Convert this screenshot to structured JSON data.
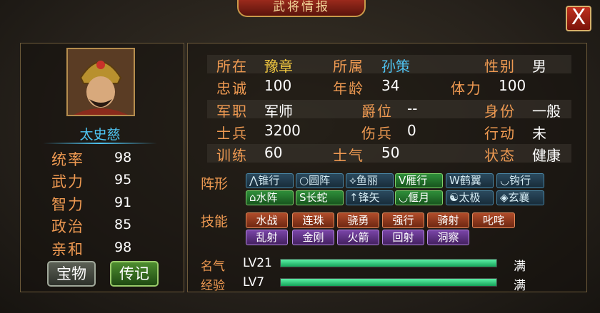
{
  "window": {
    "title": "武将情报",
    "close_label": "X"
  },
  "general": {
    "name": "太史慈",
    "attributes": [
      {
        "label": "统率",
        "value": "98"
      },
      {
        "label": "武力",
        "value": "95"
      },
      {
        "label": "智力",
        "value": "91"
      },
      {
        "label": "政治",
        "value": "85"
      },
      {
        "label": "亲和",
        "value": "98"
      }
    ],
    "buttons": {
      "treasure": "宝物",
      "bio": "传记"
    }
  },
  "info": {
    "location": {
      "label": "所在",
      "value": "豫章"
    },
    "faction": {
      "label": "所属",
      "value": "孙策"
    },
    "gender": {
      "label": "性别",
      "value": "男"
    },
    "loyalty": {
      "label": "忠诚",
      "value": "100"
    },
    "age": {
      "label": "年龄",
      "value": "34"
    },
    "stamina": {
      "label": "体力",
      "value": "100"
    },
    "post": {
      "label": "军职",
      "value": "军师"
    },
    "title": {
      "label": "爵位",
      "value": "--"
    },
    "status_rank": {
      "label": "身份",
      "value": "一般"
    },
    "soldiers": {
      "label": "士兵",
      "value": "3200"
    },
    "wounded": {
      "label": "伤兵",
      "value": "0"
    },
    "action": {
      "label": "行动",
      "value": "未"
    },
    "training": {
      "label": "训练",
      "value": "60"
    },
    "morale": {
      "label": "士气",
      "value": "50"
    },
    "state": {
      "label": "状态",
      "value": "健康"
    }
  },
  "formations": {
    "label": "阵形",
    "items": [
      {
        "glyph": "⋀",
        "name": "锥行",
        "active": false
      },
      {
        "glyph": "○",
        "name": "圆阵",
        "active": false
      },
      {
        "glyph": "⟡",
        "name": "鱼丽",
        "active": false
      },
      {
        "glyph": "V",
        "name": "雁行",
        "active": true
      },
      {
        "glyph": "W",
        "name": "鹤翼",
        "active": false
      },
      {
        "glyph": "◡",
        "name": "钩行",
        "active": false
      },
      {
        "glyph": "⌂",
        "name": "水阵",
        "active": true
      },
      {
        "glyph": "S",
        "name": "长蛇",
        "active": true
      },
      {
        "glyph": "↑",
        "name": "锋矢",
        "active": false
      },
      {
        "glyph": "◡",
        "name": "偃月",
        "active": true
      },
      {
        "glyph": "☯",
        "name": "太极",
        "active": false
      },
      {
        "glyph": "◈",
        "name": "玄襄",
        "active": false
      }
    ]
  },
  "skills": {
    "label": "技能",
    "items": [
      {
        "name": "水战",
        "style": "orange"
      },
      {
        "name": "连珠",
        "style": "orange"
      },
      {
        "name": "骁勇",
        "style": "orange"
      },
      {
        "name": "强行",
        "style": "orange"
      },
      {
        "name": "骑射",
        "style": "orange"
      },
      {
        "name": "叱咤",
        "style": "orange"
      },
      {
        "name": "乱射",
        "style": "purple"
      },
      {
        "name": "金刚",
        "style": "purple"
      },
      {
        "name": "火箭",
        "style": "purple"
      },
      {
        "name": "回射",
        "style": "purple"
      },
      {
        "name": "洞察",
        "style": "purple"
      }
    ]
  },
  "progress": {
    "fame": {
      "label": "名气",
      "level": "LV21",
      "max_text": "满",
      "fill": 1.0
    },
    "exp": {
      "label": "经验",
      "level": "LV7",
      "max_text": "满",
      "fill": 1.0
    }
  },
  "colors": {
    "label": "#ef9a52",
    "name": "#4fc4f2",
    "bar": "#15a45a"
  }
}
